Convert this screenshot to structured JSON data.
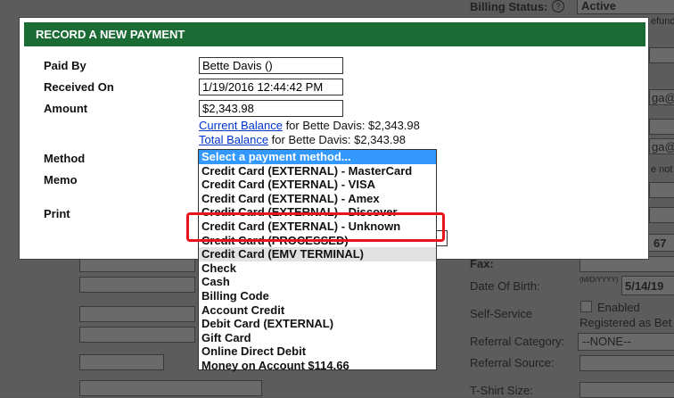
{
  "modal": {
    "title": "RECORD A NEW PAYMENT",
    "fields": {
      "paid_by_label": "Paid By",
      "paid_by_value": "Bette Davis ()",
      "received_on_label": "Received On",
      "received_on_value": "1/19/2016 12:44:42 PM",
      "amount_label": "Amount",
      "amount_value": "$2,343.98",
      "current_balance_link": "Current Balance",
      "current_balance_text": " for Bette Davis: $2,343.98",
      "total_balance_link": "Total Balance",
      "total_balance_text": " for Bette Davis: $2,343.98",
      "method_label": "Method",
      "memo_label": "Memo",
      "print_label": "Print"
    }
  },
  "method_dropdown": {
    "selected_index": 0,
    "hover_index": 7,
    "options": [
      "Select a payment method...",
      "Credit Card (EXTERNAL) - MasterCard",
      "Credit Card (EXTERNAL) - VISA",
      "Credit Card (EXTERNAL) - Amex",
      "Credit Card (EXTERNAL) - Discover",
      "Credit Card (EXTERNAL) - Unknown",
      "Credit Card (PROCESSED)",
      "Credit Card (EMV TERMINAL)",
      "Check",
      "Cash",
      "Billing Code",
      "Account Credit",
      "Debit Card (EXTERNAL)",
      "Gift Card",
      "Online Direct Debit",
      "Money on Account $114.66"
    ]
  },
  "background": {
    "billing_status_label": "Billing Status:",
    "billing_status_value": "Active",
    "refund_fragment": "efund",
    "email_fragment_1": "ga@",
    "email_fragment_2": "ga@",
    "not_fragment": "e not",
    "phone_fragment": "67",
    "fax_label": "Fax:",
    "dob_label": "Date Of Birth:",
    "dob_format": "(M/D/YYYY)",
    "dob_value": "5/14/19",
    "self_service_label": "Self-Service",
    "enabled_label": "Enabled",
    "registered_as": "Registered as Bet",
    "referral_category_label": "Referral Category:",
    "referral_category_value": "--NONE--",
    "referral_source_label": "Referral Source:",
    "tshirt_label": "T-Shirt Size:"
  },
  "colors": {
    "header_green": "#1a6b34",
    "highlight_red": "#e8141c",
    "select_blue": "#3399ff"
  }
}
